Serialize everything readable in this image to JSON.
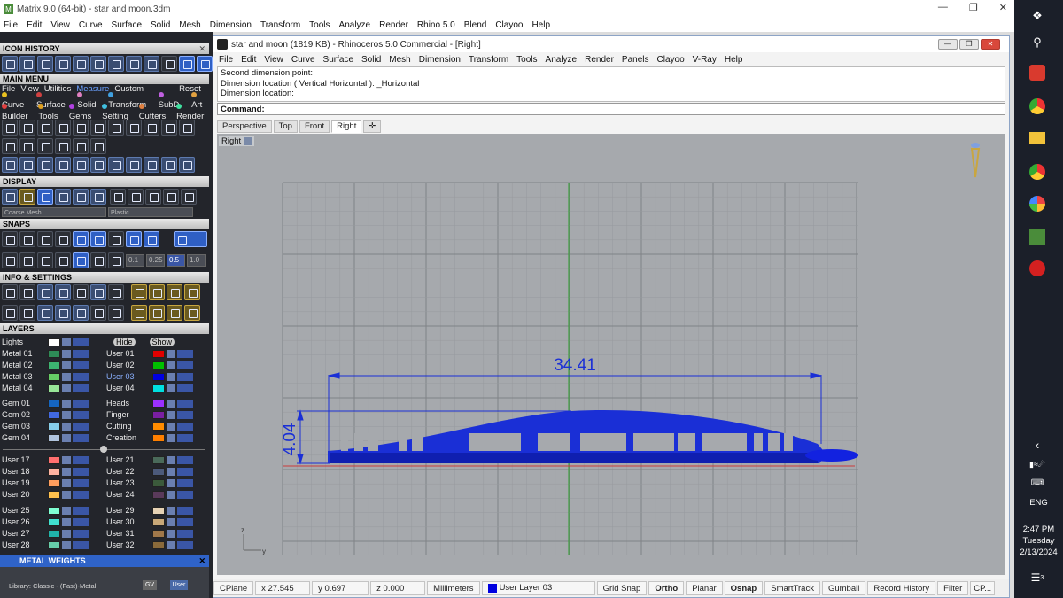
{
  "outer": {
    "title": "Matrix 9.0 (64-bit) - star and moon.3dm",
    "menu": [
      "File",
      "Edit",
      "View",
      "Curve",
      "Surface",
      "Solid",
      "Mesh",
      "Dimension",
      "Transform",
      "Tools",
      "Analyze",
      "Render",
      "Rhino 5.0",
      "Blend",
      "Clayoo",
      "Help"
    ]
  },
  "panel": {
    "icon_history": "ICON HISTORY",
    "main_menu": "MAIN MENU",
    "main_menu_row1": [
      "File",
      "View",
      "Utilities",
      "Measure",
      "Custom"
    ],
    "main_menu_reset": "Reset",
    "main_menu_row2": [
      "Curve",
      "Surface",
      "Solid",
      "Transform",
      "SubD",
      "Art"
    ],
    "main_menu_row3": [
      "Builder",
      "Tools",
      "Gems",
      "Setting",
      "Cutters",
      "Render"
    ],
    "display": "DISPLAY",
    "display_combo1": "Coarse Mesh",
    "display_combo2": "Plastic",
    "snaps": "SNAPS",
    "snap_values": [
      "0.1",
      "0.25",
      "0.5",
      "1.0"
    ],
    "info_settings": "INFO & SETTINGS",
    "layers": "LAYERS",
    "lights": "Lights",
    "hide": "Hide",
    "show": "Show",
    "layers_left": [
      "Metal 01",
      "Metal 02",
      "Metal 03",
      "Metal 04",
      "Gem 01",
      "Gem 02",
      "Gem 03",
      "Gem 04",
      "User 17",
      "User 18",
      "User 19",
      "User 20",
      "User 25",
      "User 26",
      "User 27",
      "User 28"
    ],
    "layers_right": [
      "User 01",
      "User 02",
      "User 03",
      "User 04",
      "Heads",
      "Finger",
      "Cutting",
      "Creation",
      "User 21",
      "User 22",
      "User 23",
      "User 24",
      "User 29",
      "User 30",
      "User 31",
      "User 32"
    ],
    "colors_left": [
      "#2e8b57",
      "#3cb371",
      "#66cd66",
      "#98e698",
      "#1565c0",
      "#4169e1",
      "#87ceeb",
      "#b0c4de",
      "#ff6f6f",
      "#ffb3a0",
      "#ff9e5e",
      "#ffc04d",
      "#7fffd4",
      "#40e0d0",
      "#20b2aa",
      "#66cdaa"
    ],
    "colors_right": [
      "#e00000",
      "#00c000",
      "#0000e0",
      "#00e0e0",
      "#9b30ff",
      "#7a1fa2",
      "#ff8c00",
      "#ff7f00",
      "#4a6a5a",
      "#4c5a7a",
      "#3b5a3b",
      "#5a3a5a",
      "#e6d2b4",
      "#c8a878",
      "#a0784a",
      "#8a6a3a"
    ],
    "metal_weights": "METAL WEIGHTS",
    "library": "Library: Classic - (Fast)-Metal",
    "gv": "GV",
    "user_btn": "User"
  },
  "rhino": {
    "title": "star and moon (1819 KB) - Rhinoceros 5.0 Commercial - [Right]",
    "menu": [
      "File",
      "Edit",
      "View",
      "Curve",
      "Surface",
      "Solid",
      "Mesh",
      "Dimension",
      "Transform",
      "Tools",
      "Analyze",
      "Render",
      "Panels",
      "Clayoo",
      "V-Ray",
      "Help"
    ],
    "history": [
      "Second dimension point:",
      "Dimension location ( Vertical  Horizontal ): _Horizontal",
      "Dimension location:"
    ],
    "command_label": "Command:",
    "tabs": [
      "Perspective",
      "Top",
      "Front",
      "Right"
    ],
    "viewport_label": "Right",
    "dim_width": "34.41",
    "dim_height": "4.04",
    "axis_z": "z",
    "axis_y": "y"
  },
  "status": {
    "cplane": "CPlane",
    "x": "x 27.545",
    "y": "y 0.697",
    "z": "z 0.000",
    "units": "Millimeters",
    "layer": "User Layer 03",
    "toggles": [
      "Grid Snap",
      "Ortho",
      "Planar",
      "Osnap",
      "SmartTrack",
      "Gumball",
      "Record History",
      "Filter",
      "CP..."
    ]
  },
  "taskbar": {
    "lang": "ENG",
    "time": "2:47 PM",
    "day": "Tuesday",
    "date": "2/13/2024",
    "notif_count": "3"
  },
  "colors": {
    "model_blue": "#1a2fd6",
    "grid_line": "#8e9296",
    "accent": "#2f5fc4"
  }
}
